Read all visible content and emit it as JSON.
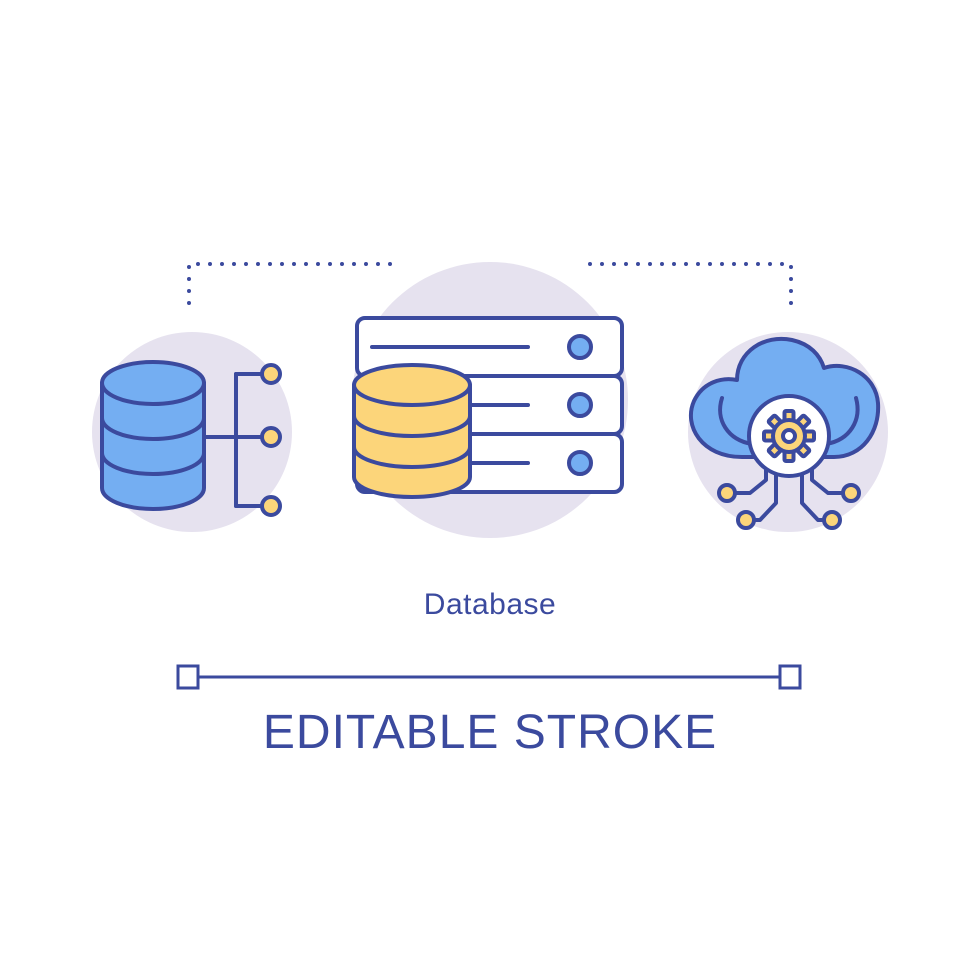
{
  "title": "Database",
  "subtitle": "EDITABLE STROKE",
  "colors": {
    "stroke": "#3b4a9e",
    "blue_fill": "#74aef2",
    "yellow_fill": "#fcd57a",
    "circle_bg": "#e6e2ef",
    "white": "#ffffff"
  },
  "icons": [
    "database-network-icon",
    "server-rack-database-icon",
    "cloud-gear-icon"
  ]
}
